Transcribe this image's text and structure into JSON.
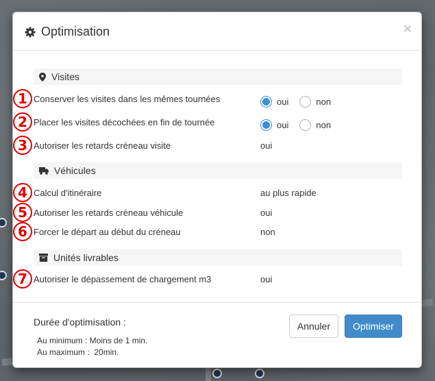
{
  "modal": {
    "title": "Optimisation",
    "close_label": "×"
  },
  "sections": {
    "visites": {
      "label": "Visites",
      "icon": "map-marker-icon"
    },
    "vehicules": {
      "label": "Véhicules",
      "icon": "truck-icon"
    },
    "unites": {
      "label": "Unités livrables",
      "icon": "archive-box-icon"
    }
  },
  "radio_options": {
    "yes": "oui",
    "no": "non"
  },
  "rows": [
    {
      "number": "1",
      "label": "Conserver les visites dans les mêmes tournées",
      "selected": "oui"
    },
    {
      "number": "2",
      "label": "Placer les visites décochées en fin de tournée",
      "selected": "oui"
    },
    {
      "number": "3",
      "label": "Autoriser les retards créneau visite",
      "value": "oui"
    },
    {
      "number": "4",
      "label": "Calcul d'itinéraire",
      "value": "au plus rapide"
    },
    {
      "number": "5",
      "label": "Autoriser les retards créneau véhicule",
      "value": "oui"
    },
    {
      "number": "6",
      "label": "Forcer le départ au début du créneau",
      "value": "non"
    },
    {
      "number": "7",
      "label": "Autoriser le dépassement de chargement m3",
      "value": "oui"
    }
  ],
  "footer": {
    "title": "Durée d'optimisation :",
    "min_line": "Au minimum : Moins de 1 min.",
    "max_line": "Au maximum :  20min.",
    "cancel_label": "Annuler",
    "submit_label": "Optimiser"
  },
  "colors": {
    "accent": "#428bca",
    "radio_checked": "#3c8fdb",
    "annotation_red": "#e00000"
  }
}
